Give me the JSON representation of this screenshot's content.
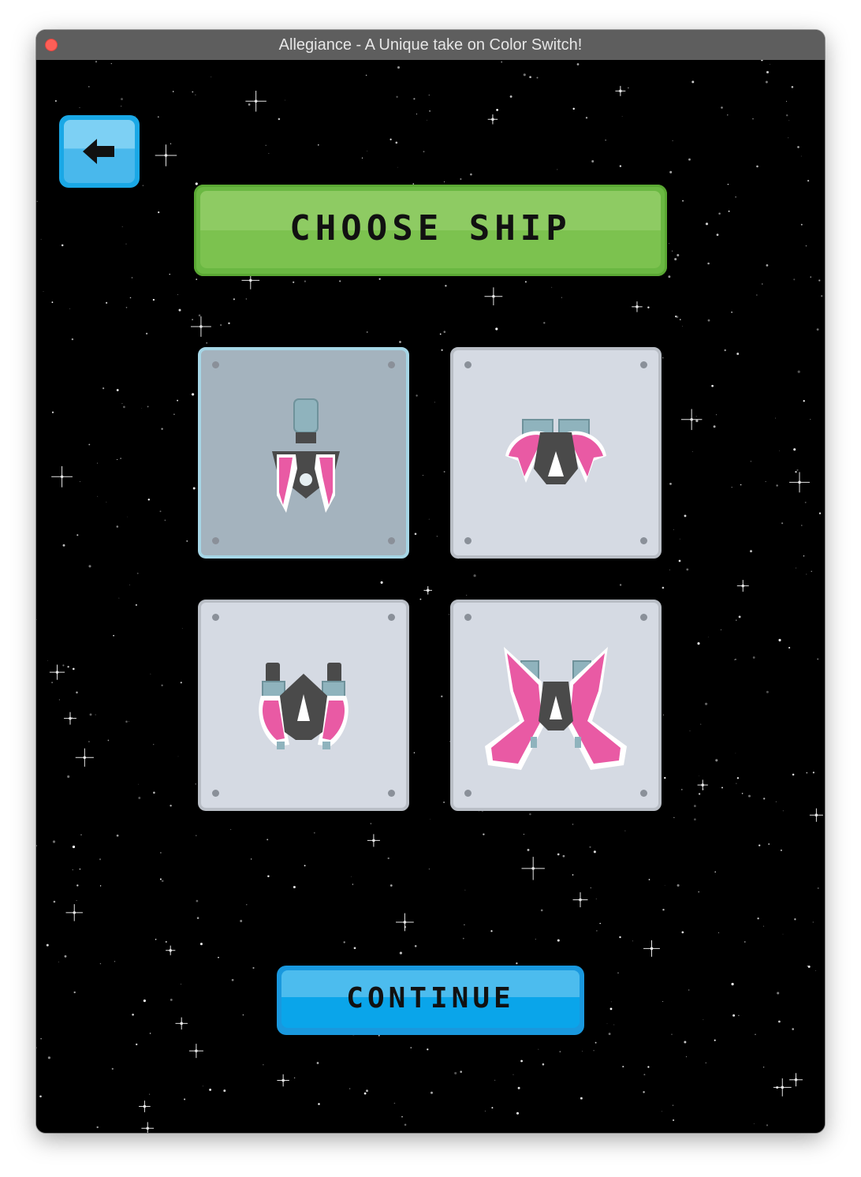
{
  "window": {
    "title": "Allegiance - A Unique take on Color Switch!"
  },
  "screen": {
    "heading": "CHOOSE SHIP",
    "continue_label": "CONTINUE",
    "back_icon": "left-arrow-icon"
  },
  "ships": [
    {
      "id": "ship-1",
      "selected": true
    },
    {
      "id": "ship-2",
      "selected": false
    },
    {
      "id": "ship-3",
      "selected": false
    },
    {
      "id": "ship-4",
      "selected": false
    }
  ],
  "colors": {
    "background": "#000000",
    "heading_banner": "#7cc24f",
    "button_blue": "#1aa8e6",
    "ship_pink": "#e95aa4",
    "ship_dark": "#4a4a4a",
    "ship_steel": "#8fb3bd",
    "tile_normal": "#d5dae3",
    "tile_selected": "#a4b3be"
  }
}
